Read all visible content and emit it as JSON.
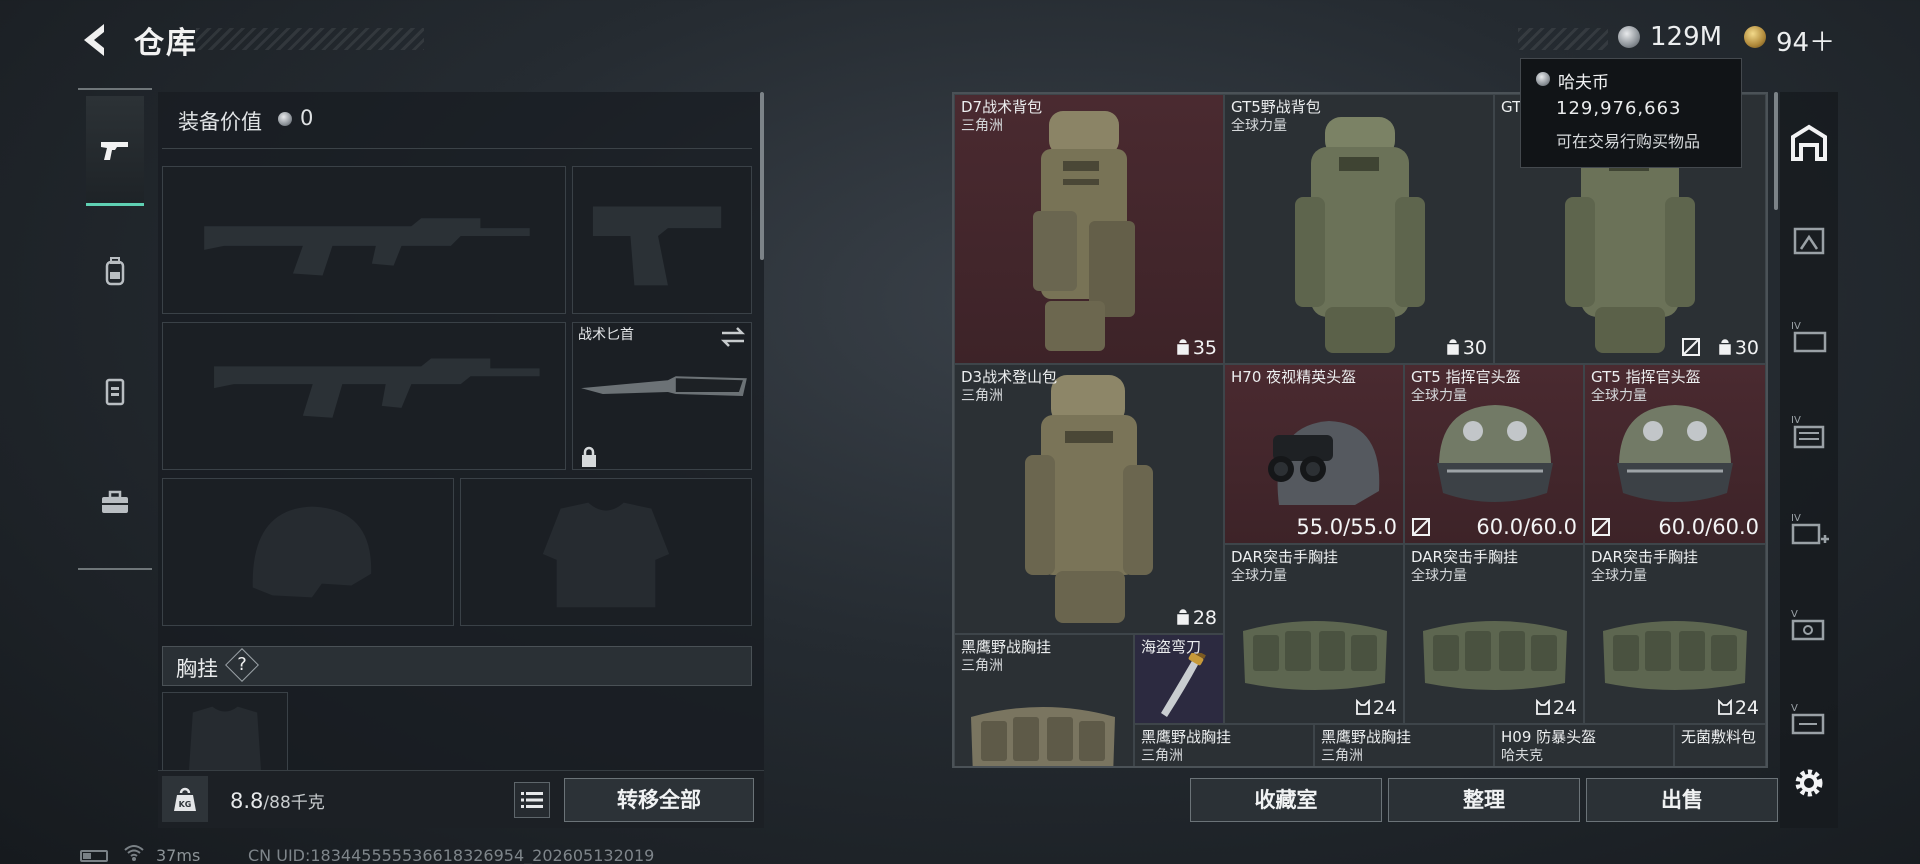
{
  "header": {
    "title": "仓库",
    "money": "129M",
    "tickets": "94＋"
  },
  "tooltip": {
    "title": "哈夫币",
    "amount": "129,976,663",
    "desc": "可在交易行购买物品"
  },
  "left_tabs": [
    {
      "icon": "pistol-icon",
      "active": true
    },
    {
      "icon": "backpack-icon",
      "active": false
    },
    {
      "icon": "vest-icon",
      "active": false
    },
    {
      "icon": "toolbox-icon",
      "active": false
    }
  ],
  "loadout": {
    "value_label": "装备价值",
    "value": "0",
    "knife_label": "战术匕首",
    "chest_label": "胸挂",
    "chest_help": "?"
  },
  "weight": {
    "current": "8.8",
    "max": "/88千克",
    "transfer_label": "转移全部"
  },
  "status": {
    "ping": "37ms",
    "uid": "CN UID:1834455555366183269​54_202605132019"
  },
  "items": [
    {
      "name": "D7战术背包",
      "sub": "三角洲",
      "count": "35",
      "kind": "backpack-tall"
    },
    {
      "name": "GT5野战背包",
      "sub": "全球力量",
      "count": "30",
      "kind": "backpack"
    },
    {
      "name": "GT5",
      "sub": "",
      "count": "30",
      "kind": "backpack"
    },
    {
      "name": "D3战术登山包",
      "sub": "三角洲",
      "count": "28",
      "kind": "backpack-tall"
    },
    {
      "name": "H70 夜视精英头盔",
      "sub": "",
      "durability": "55.0/55.0",
      "kind": "helmet-nv"
    },
    {
      "name": "GT5 指挥官头盔",
      "sub": "全球力量",
      "durability": "60.0/60.0",
      "kind": "helmet"
    },
    {
      "name": "GT5 指挥官头盔",
      "sub": "全球力量",
      "durability": "60.0/60.0",
      "kind": "helmet"
    },
    {
      "name": "DAR突击手胸挂",
      "sub": "全球力量",
      "count": "24",
      "kind": "rig"
    },
    {
      "name": "DAR突击手胸挂",
      "sub": "全球力量",
      "count": "24",
      "kind": "rig"
    },
    {
      "name": "DAR突击手胸挂",
      "sub": "全球力量",
      "count": "24",
      "kind": "rig"
    },
    {
      "name": "黑鹰野战胸挂",
      "sub": "三角洲",
      "kind": "rig"
    },
    {
      "name": "海盗弯刀",
      "sub": "",
      "kind": "knife"
    },
    {
      "name": "黑鹰野战胸挂",
      "sub": "三角洲",
      "kind": "rig"
    },
    {
      "name": "黑鹰野战胸挂",
      "sub": "三角洲",
      "kind": "rig"
    },
    {
      "name": "H09 防暴头盔",
      "sub": "哈夫克",
      "kind": "helmet"
    },
    {
      "name": "无菌敷料包",
      "sub": "",
      "kind": "medkit"
    }
  ],
  "actions": {
    "collection": "收藏室",
    "organize": "整理",
    "sell": "出售"
  },
  "right_bar": [
    {
      "icon": "storage-icon"
    },
    {
      "icon": "gift-box-icon"
    },
    {
      "icon": "expand-slot-iv-icon"
    },
    {
      "icon": "expand-slot-iv-2-icon"
    },
    {
      "icon": "add-slot-iv-icon"
    },
    {
      "icon": "slot-v-icon"
    },
    {
      "icon": "slot-v-2-icon"
    },
    {
      "icon": "settings-icon"
    }
  ],
  "colors": {
    "accent": "#5fd0b3",
    "rare_bg": "#4a2a30",
    "epic_bg": "#2c2a40"
  }
}
